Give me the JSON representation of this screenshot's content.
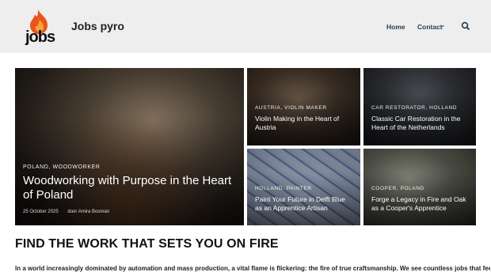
{
  "header": {
    "logo_text": "jobs",
    "brand": "Jobs pyro",
    "nav": {
      "home": "Home",
      "contact": "Contact"
    }
  },
  "featured": {
    "tags": "POLAND, WOODWORKER",
    "title": "Woodworking with Purpose in the Heart of Poland",
    "date": "25 October 2025",
    "author": "door Amira Bosman"
  },
  "cards": [
    {
      "tags": "AUSTRIA, VIOLIN MAKER",
      "title": "Violin Making in the Heart of Austria"
    },
    {
      "tags": "CAR RESTORATOR, HOLLAND",
      "title": "Classic Car Restoration in the Heart of the Netherlands"
    },
    {
      "tags": "HOLLAND, PAINTER",
      "title": "Paint Your Future in Delft Blue as an Apprentice Artisan"
    },
    {
      "tags": "COOPER, POLAND",
      "title": "Forge a Legacy in Fire and Oak as a Cooper's Apprentice"
    }
  ],
  "section": {
    "heading": "FIND THE WORK THAT SETS YOU ON FIRE",
    "intro": "In a world increasingly dominated by automation and mass production, a vital flame is flickering: the fire of true craftsmanship. We see countless jobs that feel"
  },
  "colors": {
    "header_bg": "#eeeeee",
    "nav": "#1f3b57",
    "flame": "#e8541c"
  }
}
